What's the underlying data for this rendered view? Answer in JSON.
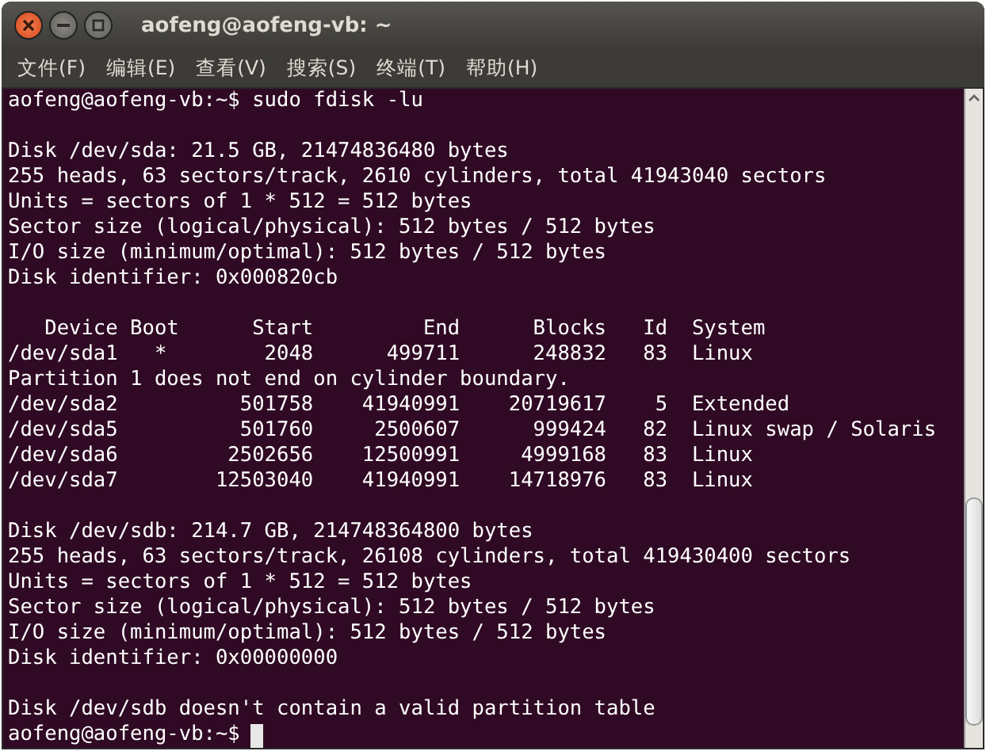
{
  "window": {
    "title": "aofeng@aofeng-vb: ~"
  },
  "menu": [
    "文件(F)",
    "编辑(E)",
    "查看(V)",
    "搜索(S)",
    "终端(T)",
    "帮助(H)"
  ],
  "terminal": {
    "blocks": [
      [
        "aofeng@aofeng-vb:~$ sudo fdisk -lu"
      ],
      [
        "Disk /dev/sda: 21.5 GB, 21474836480 bytes",
        "255 heads, 63 sectors/track, 2610 cylinders, total 41943040 sectors",
        "Units = sectors of 1 * 512 = 512 bytes",
        "Sector size (logical/physical): 512 bytes / 512 bytes",
        "I/O size (minimum/optimal): 512 bytes / 512 bytes",
        "Disk identifier: 0x000820cb"
      ],
      [
        "   Device Boot      Start         End      Blocks   Id  System",
        "/dev/sda1   *        2048      499711      248832   83  Linux",
        "Partition 1 does not end on cylinder boundary.",
        "/dev/sda2          501758    41940991    20719617    5  Extended",
        "/dev/sda5          501760     2500607      999424   82  Linux swap / Solaris",
        "/dev/sda6         2502656    12500991     4999168   83  Linux",
        "/dev/sda7        12503040    41940991    14718976   83  Linux"
      ],
      [
        "Disk /dev/sdb: 214.7 GB, 214748364800 bytes",
        "255 heads, 63 sectors/track, 26108 cylinders, total 419430400 sectors",
        "Units = sectors of 1 * 512 = 512 bytes",
        "Sector size (logical/physical): 512 bytes / 512 bytes",
        "I/O size (minimum/optimal): 512 bytes / 512 bytes",
        "Disk identifier: 0x00000000"
      ],
      [
        "Disk /dev/sdb doesn't contain a valid partition table"
      ]
    ],
    "prompt": "aofeng@aofeng-vb:~$"
  }
}
